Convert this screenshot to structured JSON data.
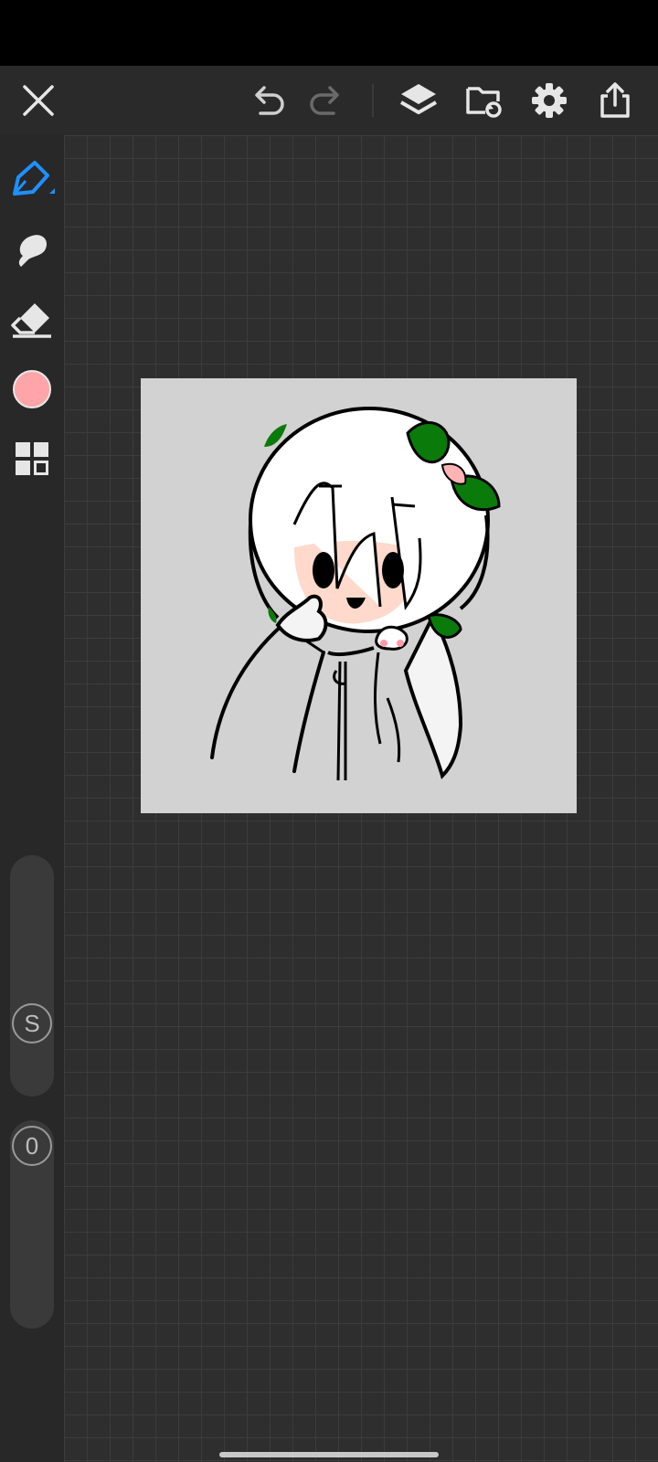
{
  "toolbar": {
    "icons": [
      "close-icon",
      "undo-icon",
      "redo-icon",
      "layers-icon",
      "import-icon",
      "settings-icon",
      "share-icon"
    ]
  },
  "tools": {
    "active": "pen",
    "items": [
      "pen-icon",
      "smudge-icon",
      "eraser-icon",
      "color-picker",
      "grid-icon"
    ],
    "accent_color": "#1e90ff"
  },
  "color": {
    "current": "#ffa4a8"
  },
  "sliders": {
    "size_label": "S",
    "opacity_label": "0"
  },
  "artboard": {
    "background": "#d2d2d2"
  }
}
